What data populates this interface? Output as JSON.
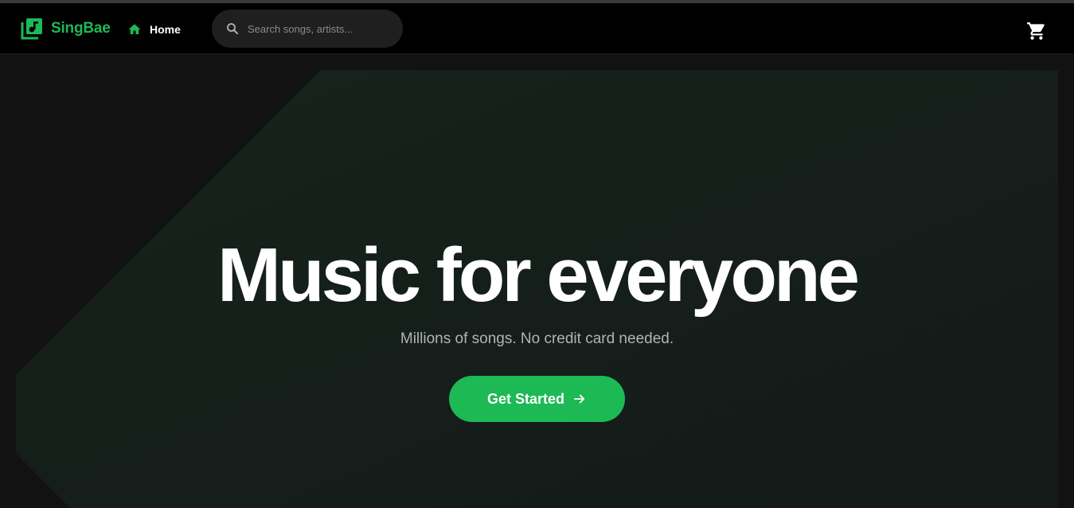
{
  "colors": {
    "accent": "#1db954",
    "nav_bg": "#000000",
    "page_bg": "#121212",
    "hero_panel": "#15201b",
    "search_bg": "#1f1f1f"
  },
  "nav": {
    "logo_text": "SingBae",
    "logo_icon": "music-library-icon",
    "home_label": "Home",
    "home_icon": "home-icon",
    "search": {
      "icon": "search-icon",
      "placeholder": "Search songs, artists..."
    },
    "cart_icon": "cart-icon"
  },
  "hero": {
    "title": "Music for everyone",
    "subtitle": "Millions of songs. No credit card needed.",
    "cta_label": "Get Started",
    "cta_icon": "arrow-right-icon"
  }
}
